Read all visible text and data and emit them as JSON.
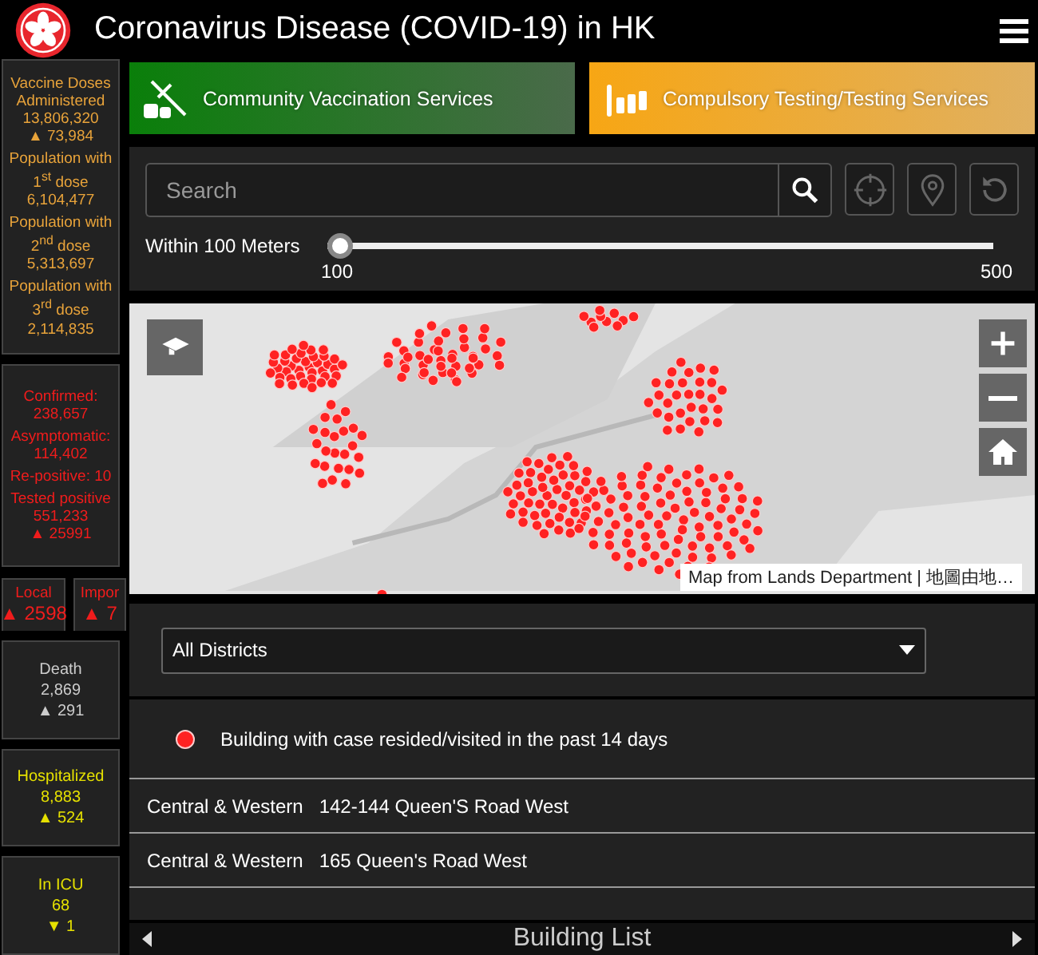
{
  "header": {
    "title": "Coronavirus Disease (COVID-19) in HK"
  },
  "stats": [
    {
      "kind": "vaccine",
      "lines": [
        "Vaccine Doses Administered",
        "13,806,320",
        "▲ 73,984",
        "Population with 1$^{st}$ dose",
        "6,104,477",
        "Population with 2$^{nd}$ dose",
        "5,313,697",
        "Population with 3$^{rd}$ dose",
        "2,114,835"
      ]
    },
    {
      "kind": "cases",
      "lines": [
        "Confirmed:",
        "238,657",
        "Asymptomatic:",
        "114,402",
        "Re-positive: 10",
        "Tested positive",
        "551,233",
        "▲ 25991"
      ]
    }
  ],
  "split_stats": [
    {
      "label": "Local",
      "value": "▲ 2598"
    },
    {
      "label": "Impor",
      "value": "▲ 7"
    }
  ],
  "small_stats": [
    {
      "kind": "death",
      "label": "Death",
      "value": "2,869",
      "change": "▲ 291"
    },
    {
      "kind": "hospital",
      "label": "Hospitalized",
      "value": "8,883",
      "change": "▲ 524"
    },
    {
      "kind": "hospital",
      "label": "In ICU",
      "value": "68",
      "change": "▼ 1"
    }
  ],
  "services": [
    {
      "kind": "vaccination",
      "label": "Community Vaccination Services"
    },
    {
      "kind": "testing",
      "label": "Compulsory Testing/Testing Services"
    }
  ],
  "search": {
    "placeholder": "Search"
  },
  "radius": {
    "label": "Within 100 Meters",
    "level": 0,
    "min": "100",
    "max": "500"
  },
  "map": {
    "attribution": "Map from Lands Department | 地圖由地…"
  },
  "district": {
    "value": "All Districts"
  },
  "legend": {
    "label": "Building with case resided/visited in the past 14 days"
  },
  "buildings": [
    {
      "district": "Central & Western",
      "address": "142-144 Queen'S Road West"
    },
    {
      "district": "Central & Western",
      "address": "165 Queen's Road West"
    }
  ],
  "footer": {
    "title": "Building List"
  }
}
